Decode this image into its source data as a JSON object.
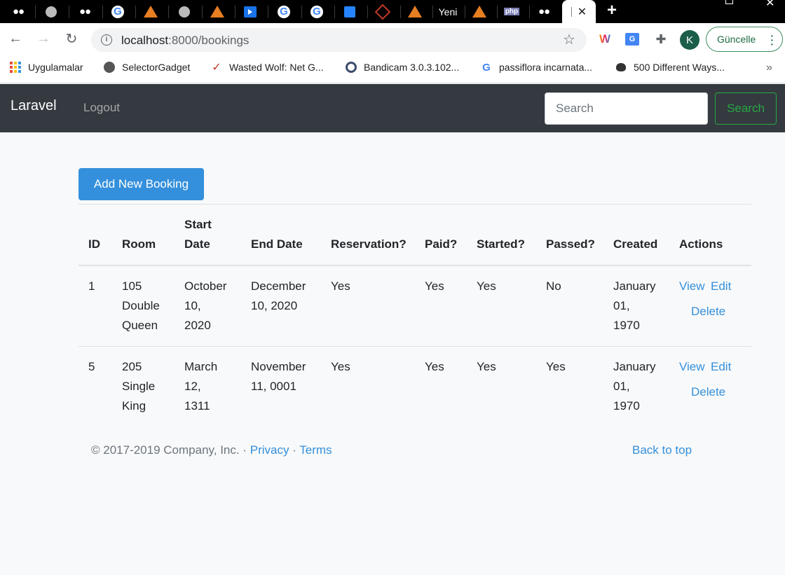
{
  "browser": {
    "tabs": [
      {
        "icon": "medium-icon",
        "glyph": "●●"
      },
      {
        "icon": "globe-icon"
      },
      {
        "icon": "medium-icon",
        "glyph": "●●"
      },
      {
        "icon": "google-icon",
        "glyph": "G"
      },
      {
        "icon": "triangle-logo-icon"
      },
      {
        "icon": "globe-icon"
      },
      {
        "icon": "triangle-logo-icon"
      },
      {
        "icon": "video-play-icon"
      },
      {
        "icon": "google-icon",
        "glyph": "G"
      },
      {
        "icon": "google-icon",
        "glyph": "G"
      },
      {
        "icon": "jira-icon"
      },
      {
        "icon": "laravel-icon"
      },
      {
        "icon": "triangle-logo-icon"
      },
      {
        "label": "Yeni"
      },
      {
        "icon": "triangle-logo-icon"
      },
      {
        "icon": "php-icon",
        "glyph": "php"
      },
      {
        "icon": "medium-icon",
        "glyph": "●●"
      },
      {
        "active": true,
        "icon": "close-icon",
        "glyph": "✕"
      }
    ],
    "new_tab_glyph": "+",
    "url_host": "localhost",
    "url_rest": ":8000/bookings",
    "profile_initial": "K",
    "update_label": "Güncelle",
    "bookmarks": [
      {
        "label": "Uygulamalar",
        "icon": "apps-icon"
      },
      {
        "label": "SelectorGadget",
        "icon": "globe-icon"
      },
      {
        "label": "Wasted Wolf: Net G...",
        "icon": "wolf-icon"
      },
      {
        "label": "Bandicam 3.0.3.102...",
        "icon": "bandicam-icon"
      },
      {
        "label": "passiflora incarnata...",
        "icon": "google-icon"
      },
      {
        "label": "500 Different Ways...",
        "icon": "bee-icon"
      }
    ],
    "bookmarks_more": "»"
  },
  "navbar": {
    "brand": "Laravel",
    "logout": "Logout",
    "search_placeholder": "Search",
    "search_button": "Search"
  },
  "main": {
    "add_button": "Add New Booking",
    "columns": {
      "id": "ID",
      "room": "Room",
      "start_1": "Start",
      "start_2": "Date",
      "end": "End Date",
      "reservation": "Reservation?",
      "paid": "Paid?",
      "started": "Started?",
      "passed": "Passed?",
      "created": "Created",
      "actions": "Actions"
    },
    "rows": [
      {
        "id": "1",
        "room": [
          "105",
          "Double",
          "Queen"
        ],
        "start": [
          "October",
          "10,",
          "2020"
        ],
        "end": [
          "December",
          "10, 2020"
        ],
        "reservation": "Yes",
        "paid": "Yes",
        "started": "Yes",
        "passed": "No",
        "created": [
          "January",
          "01,",
          "1970"
        ],
        "view": "View",
        "edit": "Edit",
        "delete": "Delete"
      },
      {
        "id": "5",
        "room": [
          "205",
          "Single",
          "King"
        ],
        "start": [
          "March",
          "12,",
          "1311"
        ],
        "end": [
          "November",
          "11, 0001"
        ],
        "reservation": "Yes",
        "paid": "Yes",
        "started": "Yes",
        "passed": "Yes",
        "created": [
          "January",
          "01,",
          "1970"
        ],
        "view": "View",
        "edit": "Edit",
        "delete": "Delete"
      }
    ]
  },
  "footer": {
    "copyright": "© 2017-2019 Company, Inc. · ",
    "privacy": "Privacy",
    "sep": " · ",
    "terms": "Terms",
    "back_to_top": "Back to top"
  }
}
